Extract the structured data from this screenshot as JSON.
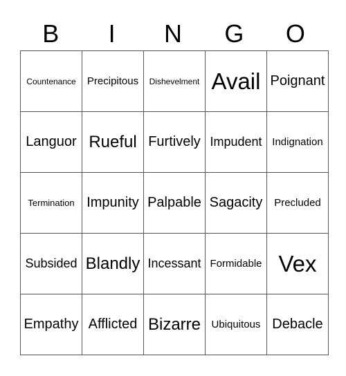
{
  "header": [
    "B",
    "I",
    "N",
    "G",
    "O"
  ],
  "rows": [
    [
      "Countenance",
      "Precipitous",
      "Dishevelment",
      "Avail",
      "Poignant"
    ],
    [
      "Languor",
      "Rueful",
      "Furtively",
      "Impudent",
      "Indignation"
    ],
    [
      "Termination",
      "Impunity",
      "Palpable",
      "Sagacity",
      "Precluded"
    ],
    [
      "Subsided",
      "Blandly",
      "Incessant",
      "Formidable",
      "Vex"
    ],
    [
      "Empathy",
      "Afflicted",
      "Bizarre",
      "Ubiquitous",
      "Debacle"
    ]
  ]
}
